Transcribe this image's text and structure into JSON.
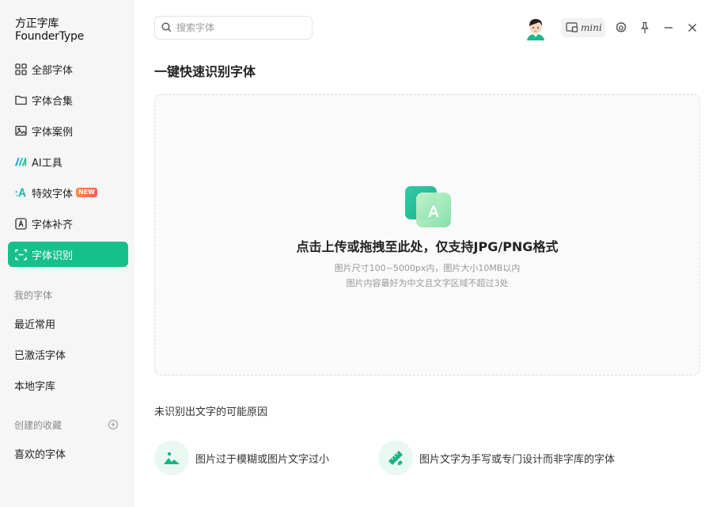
{
  "app": {
    "logo_line1": "方正字库",
    "logo_line2": "FounderType"
  },
  "sidebar": {
    "items": [
      {
        "label": "全部字体",
        "icon": "grid-icon"
      },
      {
        "label": "字体合集",
        "icon": "folder-icon"
      },
      {
        "label": "字体案例",
        "icon": "image-icon"
      },
      {
        "label": "AI工具",
        "icon": "ai-logo-icon"
      },
      {
        "label": "特效字体",
        "icon": "sparkle-a-icon",
        "badge": "NEW"
      },
      {
        "label": "字体补齐",
        "icon": "font-fill-icon"
      },
      {
        "label": "字体识别",
        "icon": "scan-icon",
        "active": true
      }
    ],
    "my_fonts_label": "我的字体",
    "my_fonts": [
      "最近常用",
      "已激活字体",
      "本地字库"
    ],
    "collections_label": "创建的收藏",
    "collections": [
      "喜欢的字体"
    ]
  },
  "topbar": {
    "search_placeholder": "搜索字体",
    "mini_label": "mini"
  },
  "main": {
    "title": "一键快速识别字体",
    "upload_title": "点击上传或拖拽至此处，仅支持JPG/PNG格式",
    "upload_hint1": "图片尺寸100~5000px内，图片大小10MB以内",
    "upload_hint2": "图片内容最好为中文且文字区域不超过3处",
    "upload_icon_letter": "A",
    "reasons_title": "未识别出文字的可能原因",
    "reasons": [
      {
        "text": "图片过于模糊或图片文字过小",
        "icon": "landscape-icon"
      },
      {
        "text": "图片文字为手写或专门设计而非字库的字体",
        "icon": "ruler-pencil-icon"
      }
    ]
  },
  "colors": {
    "accent": "#17c08a",
    "sidebar_bg": "#f6f6f7",
    "reason_circle_bg": "#eaf8f2"
  }
}
